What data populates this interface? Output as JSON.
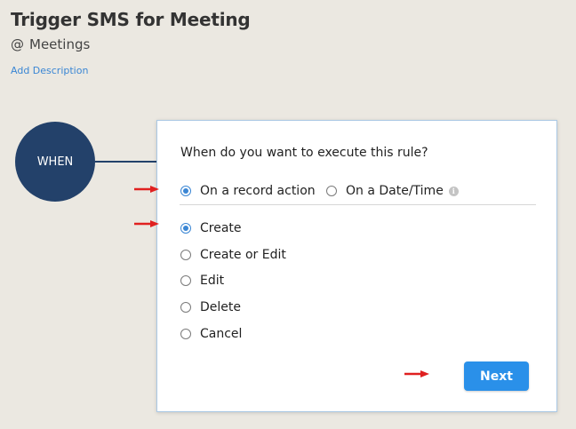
{
  "header": {
    "title": "Trigger SMS for Meeting",
    "module_prefix": "@",
    "module": "Meetings",
    "add_description": "Add Description"
  },
  "flow": {
    "when_label": "WHEN"
  },
  "panel": {
    "question": "When do you want to execute this rule?",
    "trigger_types": [
      {
        "label": "On a record action",
        "checked": true
      },
      {
        "label": "On a Date/Time",
        "checked": false
      }
    ],
    "info_icon": "info-icon",
    "actions": [
      {
        "label": "Create",
        "checked": true
      },
      {
        "label": "Create or Edit",
        "checked": false
      },
      {
        "label": "Edit",
        "checked": false
      },
      {
        "label": "Delete",
        "checked": false
      },
      {
        "label": "Cancel",
        "checked": false
      }
    ],
    "next_label": "Next"
  },
  "colors": {
    "background": "#ebe8e1",
    "when_circle": "#23416a",
    "accent": "#2a90e9",
    "annotation_arrow": "#e02020"
  }
}
